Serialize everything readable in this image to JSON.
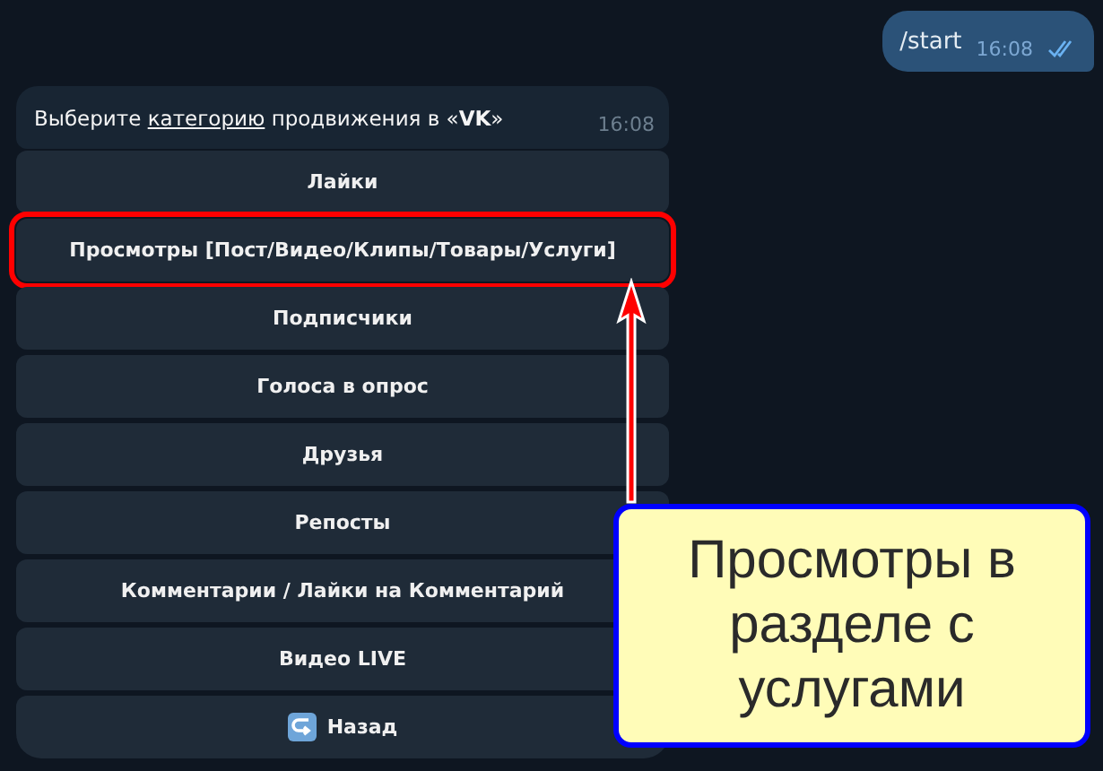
{
  "outgoing": {
    "text": "/start",
    "time": "16:08",
    "read": true
  },
  "incoming": {
    "text_before": "Выберите",
    "link": "категорию",
    "text_after": "продвижения в «**VK**»",
    "time": "16:08"
  },
  "buttons": [
    {
      "label": "Лайки",
      "highlighted": false
    },
    {
      "label": "Просмотры [Пост/Видео/Клипы/Товары/Услуги]",
      "highlighted": true
    },
    {
      "label": "Подписчики",
      "highlighted": false
    },
    {
      "label": "Голоса в опрос",
      "highlighted": false
    },
    {
      "label": "Друзья",
      "highlighted": false
    },
    {
      "label": "Репосты",
      "highlighted": false
    },
    {
      "label": "Комментарии / Лайки на Комментарий",
      "highlighted": false
    },
    {
      "label": "Видео LIVE",
      "highlighted": false
    },
    {
      "label": "Назад",
      "kind": "back",
      "highlighted": false
    }
  ],
  "callout": {
    "text": "Просмотры в разделе с услугами"
  }
}
